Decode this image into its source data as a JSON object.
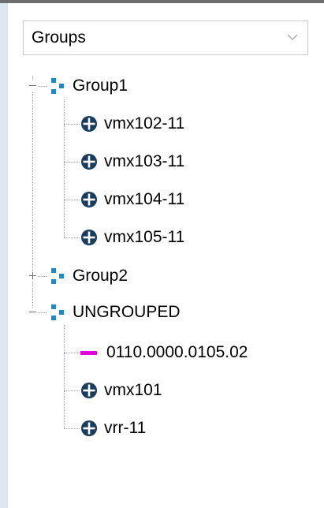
{
  "dropdown": {
    "selected": "Groups"
  },
  "colors": {
    "group_icon": "#1f88c9",
    "device_icon": "#1a3c5e",
    "link_line": "#e000d8"
  },
  "tree": {
    "group1": {
      "label": "Group1",
      "expanded": true,
      "icon": "group-icon",
      "children": [
        {
          "label": "vmx102-11",
          "icon": "router-icon"
        },
        {
          "label": "vmx103-11",
          "icon": "router-icon"
        },
        {
          "label": "vmx104-11",
          "icon": "router-icon"
        },
        {
          "label": "vmx105-11",
          "icon": "router-icon"
        }
      ]
    },
    "group2": {
      "label": "Group2",
      "expanded": false,
      "icon": "group-icon"
    },
    "ungrouped": {
      "label": "UNGROUPED",
      "expanded": true,
      "icon": "group-icon",
      "children": [
        {
          "label": "0110.0000.0105.02",
          "icon": "link-icon"
        },
        {
          "label": "vmx101",
          "icon": "router-icon"
        },
        {
          "label": "vrr-11",
          "icon": "router-icon"
        }
      ]
    }
  }
}
